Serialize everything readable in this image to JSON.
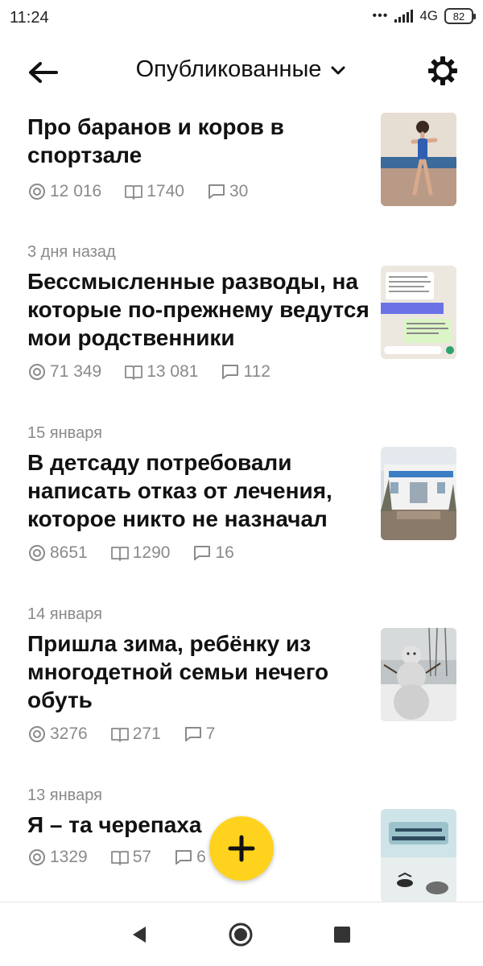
{
  "status_bar": {
    "time": "11:24",
    "dots": "•••",
    "network": "4G",
    "battery": "82"
  },
  "header": {
    "title": "Опубликованные",
    "icons": [
      "back-arrow-icon",
      "chevron-down-icon",
      "gear-icon"
    ]
  },
  "feed": {
    "peek_text": "...",
    "articles": [
      {
        "date": "",
        "title": "Про баранов и коров в спортзале",
        "views": "12 016",
        "reads": "1740",
        "comments": "30",
        "thumbnail": "gymnast-girl-photo"
      },
      {
        "date": "3 дня назад",
        "title": "Бессмысленные разводы, на которые по-прежнему ведутся мои родственники",
        "views": "71 349",
        "reads": "13 081",
        "comments": "112",
        "thumbnail": "chat-screenshot"
      },
      {
        "date": "15 января",
        "title": "В детсаду потребовали написать отказ от лечения, которое никто не назначал",
        "views": "8651",
        "reads": "1290",
        "comments": "16",
        "thumbnail": "kindergarten-building-photo"
      },
      {
        "date": "14 января",
        "title": "Пришла зима, ребёнку из многодетной семьи нечего обуть",
        "views": "3276",
        "reads": "271",
        "comments": "7",
        "thumbnail": "snowman-photo"
      },
      {
        "date": "13 января",
        "title": "Я – та черепаха",
        "views": "1329",
        "reads": "57",
        "comments": "6",
        "thumbnail": "turtle-illustration"
      }
    ]
  },
  "fab": {
    "label": "+",
    "color": "#ffd21e"
  },
  "nav": {
    "icons": [
      "back-triangle-icon",
      "home-circle-icon",
      "recents-square-icon"
    ]
  }
}
